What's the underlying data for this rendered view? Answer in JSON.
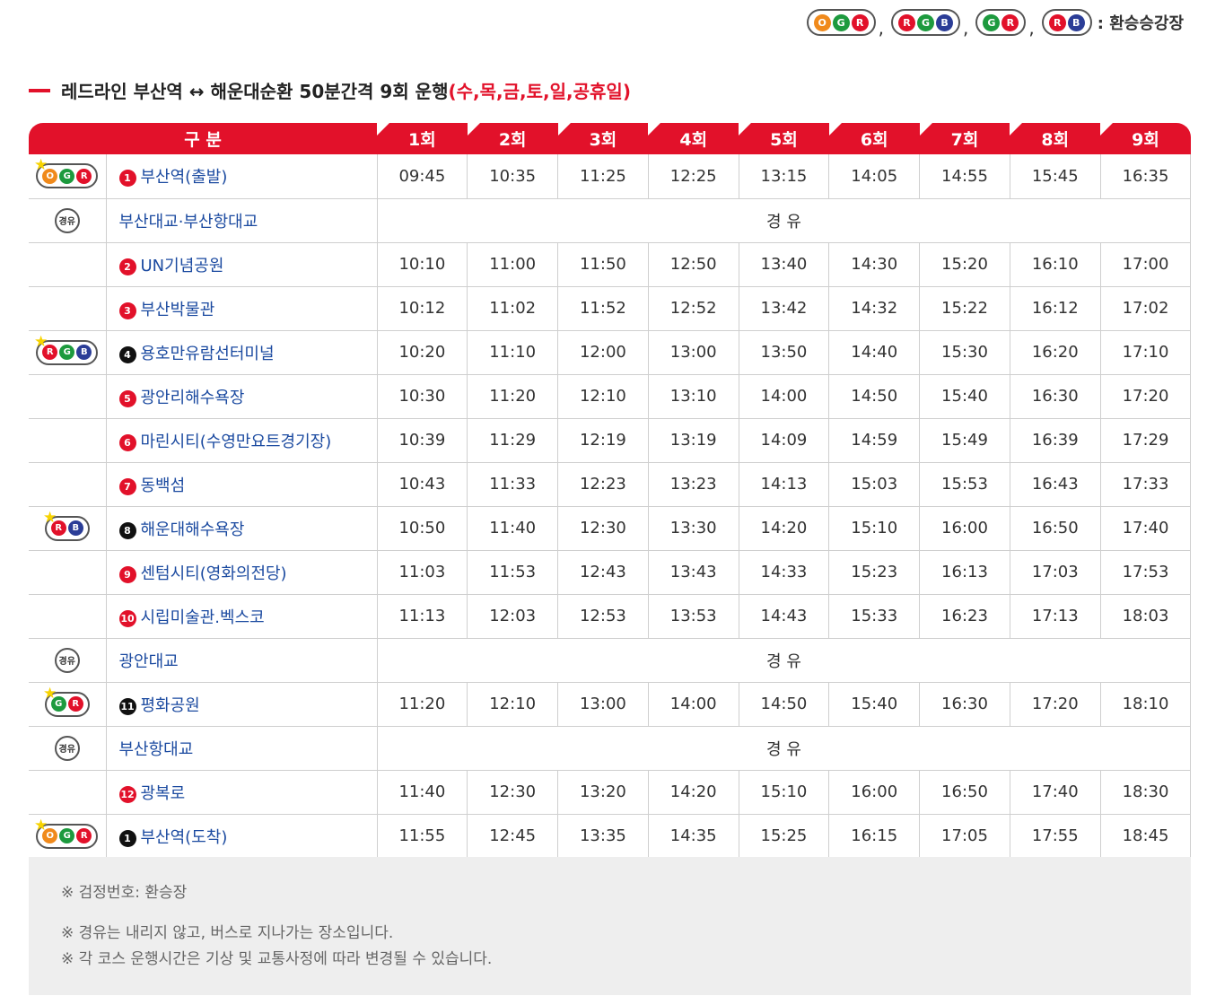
{
  "legend": {
    "groups": [
      [
        "O",
        "G",
        "R"
      ],
      [
        "R",
        "G",
        "B"
      ],
      [
        "G",
        "R"
      ],
      [
        "R",
        "B"
      ]
    ],
    "label": ": 환승승강장"
  },
  "title": {
    "main": "레드라인 부산역 ↔ 해운대순환 50분간격 9회 운행",
    "days": "(수,목,금,토,일,공휴일)"
  },
  "table": {
    "header_label": "구 분",
    "trips": [
      "1회",
      "2회",
      "3회",
      "4회",
      "5회",
      "6회",
      "7회",
      "8회",
      "9회"
    ],
    "via_text": "경 유",
    "via_badge": "경유",
    "rows": [
      {
        "kind": "stop",
        "transfer": [
          "O",
          "G",
          "R"
        ],
        "num": "1",
        "num_style": "red",
        "name": "부산역(출발)",
        "times": [
          "09:45",
          "10:35",
          "11:25",
          "12:25",
          "13:15",
          "14:05",
          "14:55",
          "15:45",
          "16:35"
        ]
      },
      {
        "kind": "via",
        "name": "부산대교·부산항대교"
      },
      {
        "kind": "stop",
        "transfer": [],
        "num": "2",
        "num_style": "red",
        "name": "UN기념공원",
        "times": [
          "10:10",
          "11:00",
          "11:50",
          "12:50",
          "13:40",
          "14:30",
          "15:20",
          "16:10",
          "17:00"
        ]
      },
      {
        "kind": "stop",
        "transfer": [],
        "num": "3",
        "num_style": "red",
        "name": "부산박물관",
        "times": [
          "10:12",
          "11:02",
          "11:52",
          "12:52",
          "13:42",
          "14:32",
          "15:22",
          "16:12",
          "17:02"
        ]
      },
      {
        "kind": "stop",
        "transfer": [
          "R",
          "G",
          "B"
        ],
        "num": "4",
        "num_style": "black",
        "name": "용호만유람선터미널",
        "times": [
          "10:20",
          "11:10",
          "12:00",
          "13:00",
          "13:50",
          "14:40",
          "15:30",
          "16:20",
          "17:10"
        ]
      },
      {
        "kind": "stop",
        "transfer": [],
        "num": "5",
        "num_style": "red",
        "name": "광안리해수욕장",
        "times": [
          "10:30",
          "11:20",
          "12:10",
          "13:10",
          "14:00",
          "14:50",
          "15:40",
          "16:30",
          "17:20"
        ]
      },
      {
        "kind": "stop",
        "transfer": [],
        "num": "6",
        "num_style": "red",
        "name": "마린시티(수영만요트경기장)",
        "times": [
          "10:39",
          "11:29",
          "12:19",
          "13:19",
          "14:09",
          "14:59",
          "15:49",
          "16:39",
          "17:29"
        ]
      },
      {
        "kind": "stop",
        "transfer": [],
        "num": "7",
        "num_style": "red",
        "name": "동백섬",
        "times": [
          "10:43",
          "11:33",
          "12:23",
          "13:23",
          "14:13",
          "15:03",
          "15:53",
          "16:43",
          "17:33"
        ]
      },
      {
        "kind": "stop",
        "transfer": [
          "R",
          "B"
        ],
        "num": "8",
        "num_style": "black",
        "name": "해운대해수욕장",
        "times": [
          "10:50",
          "11:40",
          "12:30",
          "13:30",
          "14:20",
          "15:10",
          "16:00",
          "16:50",
          "17:40"
        ]
      },
      {
        "kind": "stop",
        "transfer": [],
        "num": "9",
        "num_style": "red",
        "name": "센텀시티(영화의전당)",
        "times": [
          "11:03",
          "11:53",
          "12:43",
          "13:43",
          "14:33",
          "15:23",
          "16:13",
          "17:03",
          "17:53"
        ]
      },
      {
        "kind": "stop",
        "transfer": [],
        "num": "10",
        "num_style": "red",
        "name": "시립미술관.벡스코",
        "times": [
          "11:13",
          "12:03",
          "12:53",
          "13:53",
          "14:43",
          "15:33",
          "16:23",
          "17:13",
          "18:03"
        ]
      },
      {
        "kind": "via",
        "name": "광안대교"
      },
      {
        "kind": "stop",
        "transfer": [
          "G",
          "R"
        ],
        "num": "11",
        "num_style": "black",
        "name": "평화공원",
        "times": [
          "11:20",
          "12:10",
          "13:00",
          "14:00",
          "14:50",
          "15:40",
          "16:30",
          "17:20",
          "18:10"
        ]
      },
      {
        "kind": "via",
        "name": "부산항대교"
      },
      {
        "kind": "stop",
        "transfer": [],
        "num": "12",
        "num_style": "red",
        "name": "광복로",
        "times": [
          "11:40",
          "12:30",
          "13:20",
          "14:20",
          "15:10",
          "16:00",
          "16:50",
          "17:40",
          "18:30"
        ]
      },
      {
        "kind": "stop",
        "transfer": [
          "O",
          "G",
          "R"
        ],
        "num": "1",
        "num_style": "black",
        "name": "부산역(도착)",
        "times": [
          "11:55",
          "12:45",
          "13:35",
          "14:35",
          "15:25",
          "16:15",
          "17:05",
          "17:55",
          "18:45"
        ]
      }
    ]
  },
  "notes": [
    "※ 검정번호: 환승장",
    "※ 경유는 내리지 않고, 버스로 지나가는 장소입니다.",
    "※ 각 코스 운행시간은 기상 및 교통사정에 따라 변경될 수 있습니다."
  ],
  "colors": {
    "red": "#e2112a",
    "orange": "#f08a1c",
    "green": "#1d9a3e",
    "blue": "#2b3d97",
    "link": "#1b4aa0"
  }
}
